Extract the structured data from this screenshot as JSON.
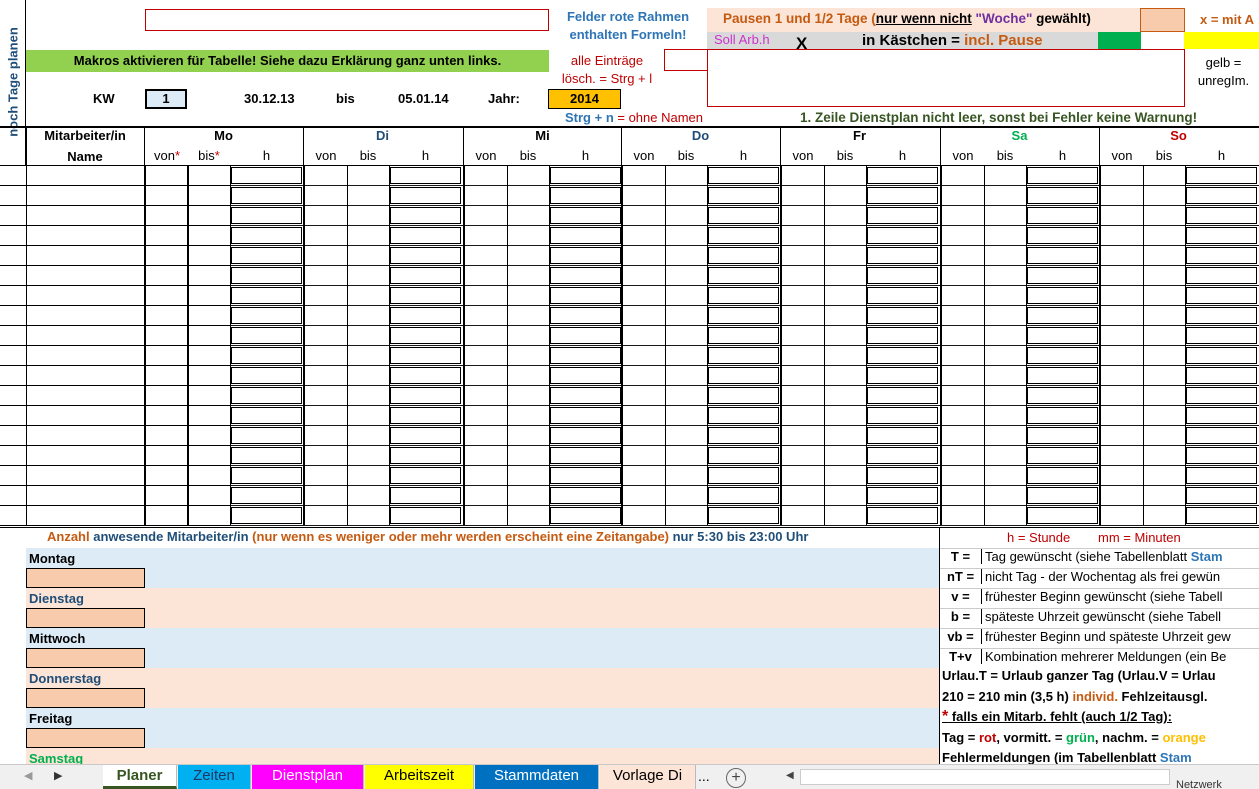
{
  "side_label": "noch Tage planen",
  "top": {
    "felder_line1": "Felder rote Rahmen",
    "felder_line2": "enthalten Formeln!",
    "pausen_a": "Pausen 1 und 1/2 Tage (",
    "pausen_b": "nur wenn nicht",
    "pausen_c": " \"Woche\"",
    "pausen_d": " gewählt)",
    "x_mit": "x = mit A",
    "soll_arb": "Soll Arb.h",
    "x_mark": "X",
    "kaestchen_a": "in Kästchen = ",
    "kaestchen_b": "incl. Pause",
    "makros": "Makros aktivieren für Tabelle! Siehe dazu Erklärung ganz unten links.",
    "alle_eintraege": "alle Einträge",
    "loesch": "lösch. = Strg + l",
    "gelb": "gelb =",
    "unregelm": "unregIm.",
    "kw_label": "KW",
    "kw_value": "1",
    "date_from": "30.12.13",
    "bis": "bis",
    "date_to": "05.01.14",
    "jahr_label": "Jahr:",
    "jahr_value": "2014",
    "strg_n_a": "Strg + n",
    "strg_n_b": " = ohne Namen",
    "warnung": "1. Zeile Dienstplan nicht leer, sonst bei Fehler keine Warnung!"
  },
  "table": {
    "col1_line1": "Mitarbeiter/in",
    "col1_line2": "Name",
    "days": [
      {
        "name": "Mo",
        "color": "#000000"
      },
      {
        "name": "Di",
        "color": "#1f4e79"
      },
      {
        "name": "Mi",
        "color": "#000000"
      },
      {
        "name": "Do",
        "color": "#1f4e79"
      },
      {
        "name": "Fr",
        "color": "#000000"
      },
      {
        "name": "Sa",
        "color": "#00b050"
      },
      {
        "name": "So",
        "color": "#c00000"
      }
    ],
    "sub_von": "von",
    "sub_bis": "bis",
    "sub_h": "h",
    "star": "*"
  },
  "anzahl": {
    "a": "Anzahl",
    "b": " anwesende Mitarbeiter/in ",
    "c": "(nur wenn es weniger oder mehr werden erscheint eine Zeitangabe)",
    "d": " nur  5:30 bis 23:00 Uhr",
    "h_stunde": "h = Stunde",
    "mm_minuten": "mm = Minuten"
  },
  "weekdays": [
    {
      "name": "Montag",
      "color": "#000000",
      "bg": "#ddebf7"
    },
    {
      "name": "Dienstag",
      "color": "#1f4e79",
      "bg": "#fce4d6"
    },
    {
      "name": "Mittwoch",
      "color": "#000000",
      "bg": "#ddebf7"
    },
    {
      "name": "Donnerstag",
      "color": "#1f4e79",
      "bg": "#fce4d6"
    },
    {
      "name": "Freitag",
      "color": "#000000",
      "bg": "#ddebf7"
    },
    {
      "name": "Samstag",
      "color": "#00b050",
      "bg": "#fce4d6"
    }
  ],
  "legend": [
    {
      "key": "T =",
      "text": "Tag gewünscht (siehe Tabellenblatt ",
      "extra": "Stam"
    },
    {
      "key": "nT =",
      "text": "nicht Tag - der Wochentag als frei gewün",
      "extra": ""
    },
    {
      "key": "v =",
      "text": "frühester Beginn gewünscht (siehe Tabell",
      "extra": ""
    },
    {
      "key": "b =",
      "text": "späteste Uhrzeit gewünscht (siehe Tabell",
      "extra": ""
    },
    {
      "key": "vb =",
      "text": "frühester Beginn und späteste Uhrzeit gew",
      "extra": ""
    },
    {
      "key": "T+v",
      "text": "Kombination mehrerer Meldungen (ein Be",
      "extra": ""
    }
  ],
  "legend_extra": {
    "urlau": "Urlau.T = Urlaub ganzer Tag (Urlau.V = Urlau",
    "min_a": "210 = 210 min (3,5 h) ",
    "min_b": "individ.",
    "min_c": " Fehlzeitausgl.",
    "star_a": "*",
    "star_b": " falls ein Mitarb. fehlt (auch 1/2 Tag):",
    "tag_a": "Tag = ",
    "tag_rot": "rot",
    "tag_b": ", vormitt. = ",
    "tag_gruen": "grün",
    "tag_c": ", nachm. = ",
    "tag_orange": "orange",
    "fehler_a": "Fehlermeldungen (im Tabellenblatt ",
    "fehler_b": "Stam"
  },
  "tabs": [
    {
      "label": "Planer",
      "bg": "#ffffff",
      "color": "#375623"
    },
    {
      "label": "Zeiten",
      "bg": "#00b0f0",
      "color": "#1f3864"
    },
    {
      "label": "Dienstplan",
      "bg": "#ff00ff",
      "color": "#ffffff"
    },
    {
      "label": "Arbeitszeit",
      "bg": "#ffff00",
      "color": "#000000"
    },
    {
      "label": "Stammdaten",
      "bg": "#0070c0",
      "color": "#ffffff"
    },
    {
      "label": "Vorlage Di",
      "bg": "#fce4d6",
      "color": "#000000"
    }
  ],
  "tab_more": "...",
  "netzwerk": "Netzwerk"
}
